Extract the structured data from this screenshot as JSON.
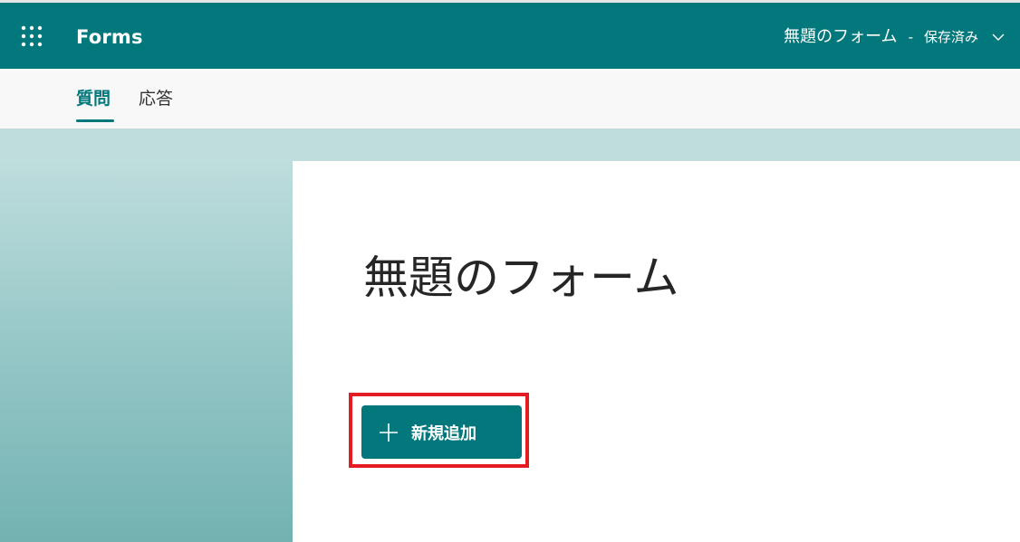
{
  "header": {
    "app_name": "Forms",
    "form_title": "無題のフォーム",
    "separator": "-",
    "save_status": "保存済み",
    "waffle_icon": "app-launcher-icon",
    "chevron_icon": "chevron-down-icon"
  },
  "tabs": [
    {
      "label": "質問",
      "active": true
    },
    {
      "label": "応答",
      "active": false
    }
  ],
  "form": {
    "title": "無題のフォーム",
    "add_button_label": "新規追加",
    "add_icon": "plus-icon"
  },
  "colors": {
    "brand": "#03787c",
    "highlight": "#e31c23",
    "band": "#bfdddd"
  }
}
